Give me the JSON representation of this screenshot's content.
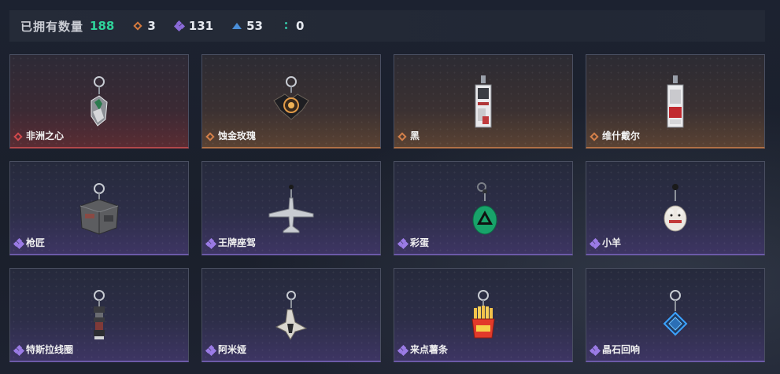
{
  "header": {
    "owned_label": "已拥有数量",
    "owned_total": "188",
    "stats": [
      {
        "icon": "orange-diamond-icon",
        "value": "3",
        "color": "#d57a3e"
      },
      {
        "icon": "purple-clover-icon",
        "value": "131",
        "color": "#8a6ad8"
      },
      {
        "icon": "blue-triangle-icon",
        "value": "53",
        "color": "#4a8ed8"
      },
      {
        "icon": "teal-dots-icon",
        "value": "0",
        "color": "#35c4a6"
      }
    ]
  },
  "items": [
    {
      "name": "非洲之心",
      "rarity": "red",
      "charm": "heart-charm-icon"
    },
    {
      "name": "蚀金玫瑰",
      "rarity": "orange",
      "charm": "rose-charm-icon"
    },
    {
      "name": "黑",
      "rarity": "orange",
      "charm": "tag-charm-icon"
    },
    {
      "name": "维什戴尔",
      "rarity": "orange",
      "charm": "card-charm-icon"
    },
    {
      "name": "枪匠",
      "rarity": "purple",
      "charm": "crate-charm-icon"
    },
    {
      "name": "王牌座驾",
      "rarity": "purple",
      "charm": "jet-charm-icon"
    },
    {
      "name": "彩蛋",
      "rarity": "purple",
      "charm": "egg-charm-icon"
    },
    {
      "name": "小羊",
      "rarity": "purple",
      "charm": "lamb-charm-icon"
    },
    {
      "name": "特斯拉线圈",
      "rarity": "purple",
      "charm": "coil-charm-icon"
    },
    {
      "name": "阿米娅",
      "rarity": "purple",
      "charm": "bunny-charm-icon"
    },
    {
      "name": "来点薯条",
      "rarity": "purple",
      "charm": "fries-charm-icon"
    },
    {
      "name": "晶石回响",
      "rarity": "purple",
      "charm": "crystal-charm-icon"
    }
  ]
}
